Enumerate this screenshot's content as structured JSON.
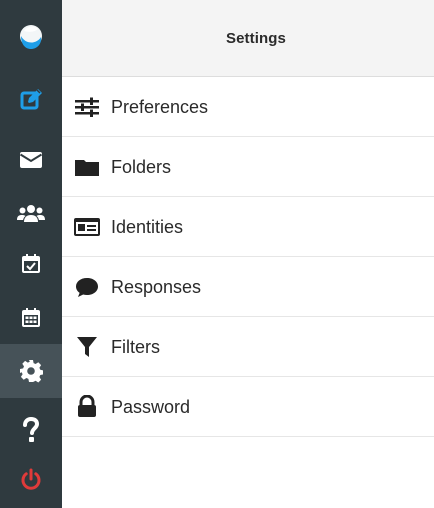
{
  "app": {
    "title": "Settings",
    "accent_color": "#1f9ee8",
    "danger_color": "#e03a3a"
  },
  "rail": {
    "items": [
      {
        "name": "logo",
        "icon": "app-logo"
      },
      {
        "name": "compose",
        "icon": "compose-icon"
      },
      {
        "name": "mail",
        "icon": "mail-icon"
      },
      {
        "name": "contacts",
        "icon": "contacts-icon"
      },
      {
        "name": "tasks",
        "icon": "calendar-check-icon"
      },
      {
        "name": "calendar",
        "icon": "calendar-icon"
      },
      {
        "name": "settings",
        "icon": "gear-icon",
        "active": true
      },
      {
        "name": "help",
        "icon": "help-icon"
      },
      {
        "name": "logout",
        "icon": "power-icon"
      }
    ]
  },
  "settings": {
    "items": [
      {
        "label": "Preferences",
        "icon": "sliders-icon"
      },
      {
        "label": "Folders",
        "icon": "folder-icon"
      },
      {
        "label": "Identities",
        "icon": "id-card-icon"
      },
      {
        "label": "Responses",
        "icon": "comment-icon"
      },
      {
        "label": "Filters",
        "icon": "filter-icon"
      },
      {
        "label": "Password",
        "icon": "lock-icon"
      }
    ]
  }
}
